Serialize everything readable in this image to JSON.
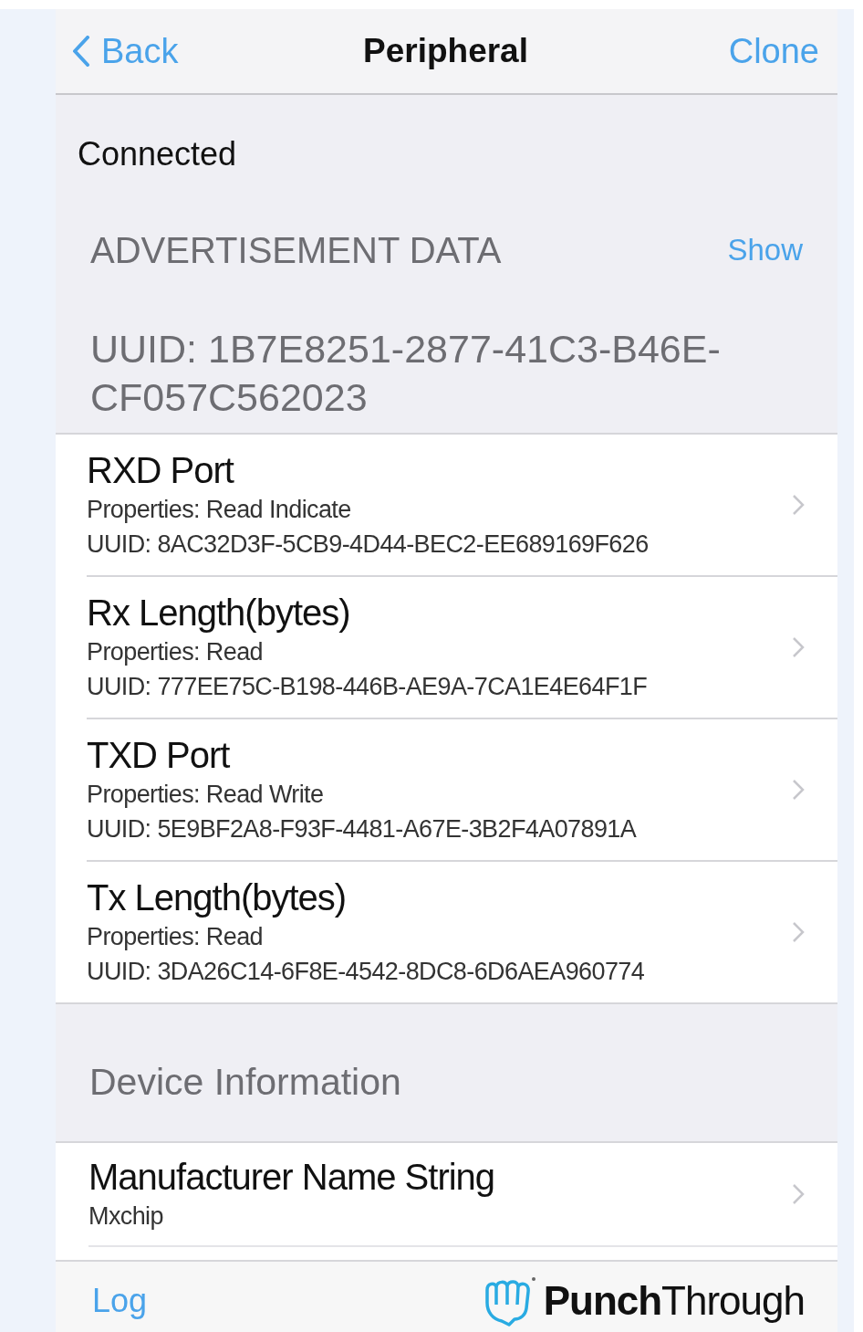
{
  "nav": {
    "back": "Back",
    "title": "Peripheral",
    "action": "Clone"
  },
  "status": "Connected",
  "advertisement": {
    "header": "ADVERTISEMENT DATA",
    "action": "Show"
  },
  "service_uuid": "UUID: 1B7E8251-2877-41C3-B46E-CF057C562023",
  "characteristics": [
    {
      "name": "RXD Port",
      "properties": "Properties: Read Indicate",
      "uuid": "UUID: 8AC32D3F-5CB9-4D44-BEC2-EE689169F626"
    },
    {
      "name": "Rx Length(bytes)",
      "properties": "Properties: Read",
      "uuid": "UUID: 777EE75C-B198-446B-AE9A-7CA1E4E64F1F"
    },
    {
      "name": "TXD Port",
      "properties": "Properties: Read Write",
      "uuid": "UUID: 5E9BF2A8-F93F-4481-A67E-3B2F4A07891A"
    },
    {
      "name": "Tx Length(bytes)",
      "properties": "Properties: Read",
      "uuid": "UUID: 3DA26C14-6F8E-4542-8DC8-6D6AEA960774"
    }
  ],
  "device_info": {
    "header": "Device Information",
    "items": [
      {
        "name": "Manufacturer Name String",
        "value": "Mxchip"
      }
    ]
  },
  "toolbar": {
    "log": "Log",
    "brand": "**Punch**Through"
  }
}
